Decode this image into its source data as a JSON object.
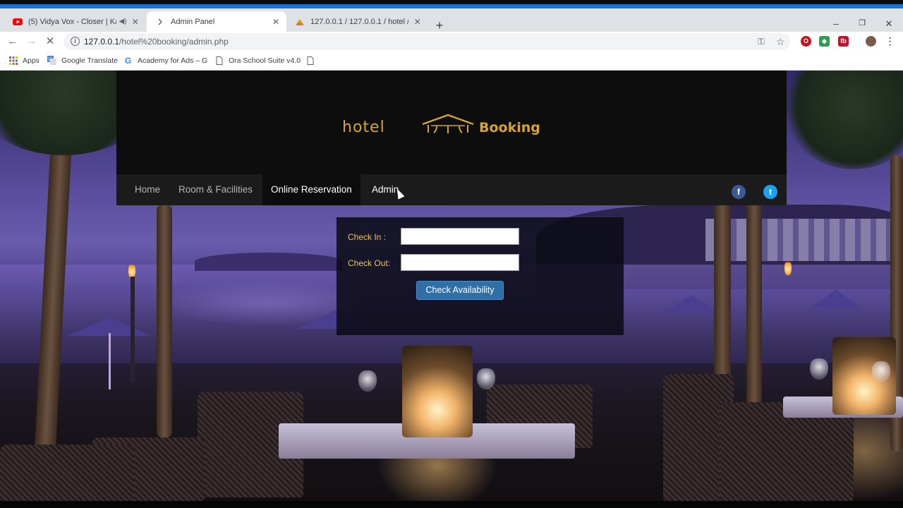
{
  "browser": {
    "tabs": [
      {
        "title": "(5) Vidya Vox - Closer | Kabir",
        "favicon": "youtube-icon",
        "playing": true
      },
      {
        "title": "Admin Panel",
        "favicon": "loading-icon",
        "active": true
      },
      {
        "title": "127.0.0.1 / 127.0.0.1 / hotel / m",
        "favicon": "phpmyadmin-icon"
      }
    ],
    "new_tab_label": "+",
    "url": {
      "host": "127.0.0.1",
      "path": "/hotel%20booking/admin.php"
    },
    "bookmarks": [
      {
        "label": "Apps",
        "icon": "apps-grid-icon"
      },
      {
        "label": "Google Translate",
        "icon": "translate-icon"
      },
      {
        "label": "Academy for Ads – G",
        "icon": "google-icon"
      },
      {
        "label": "Ora School Suite v4.0",
        "icon": "page-icon"
      },
      {
        "label": "",
        "icon": "page-icon"
      }
    ],
    "window_controls": {
      "minimize": "–",
      "maximize": "❐",
      "close": "✕"
    }
  },
  "site": {
    "logo": {
      "left_text": "hotel",
      "right_text": "Booking"
    },
    "nav": {
      "home": "Home",
      "rooms": "Room & Facilities",
      "reservation": "Online Reservation",
      "admin": "Admin"
    },
    "social": {
      "facebook": "f",
      "twitter": "t"
    },
    "reservation_form": {
      "check_in_label": "Check In :",
      "check_out_label": "Check Out:",
      "check_in_value": "",
      "check_out_value": "",
      "submit_label": "Check Availability"
    }
  },
  "colors": {
    "accent_gold": "#d8a52c",
    "nav_bg": "#1b1b1b",
    "button_blue": "#2f6fa8",
    "facebook_blue": "#3b5998",
    "twitter_blue": "#1da1f2"
  }
}
